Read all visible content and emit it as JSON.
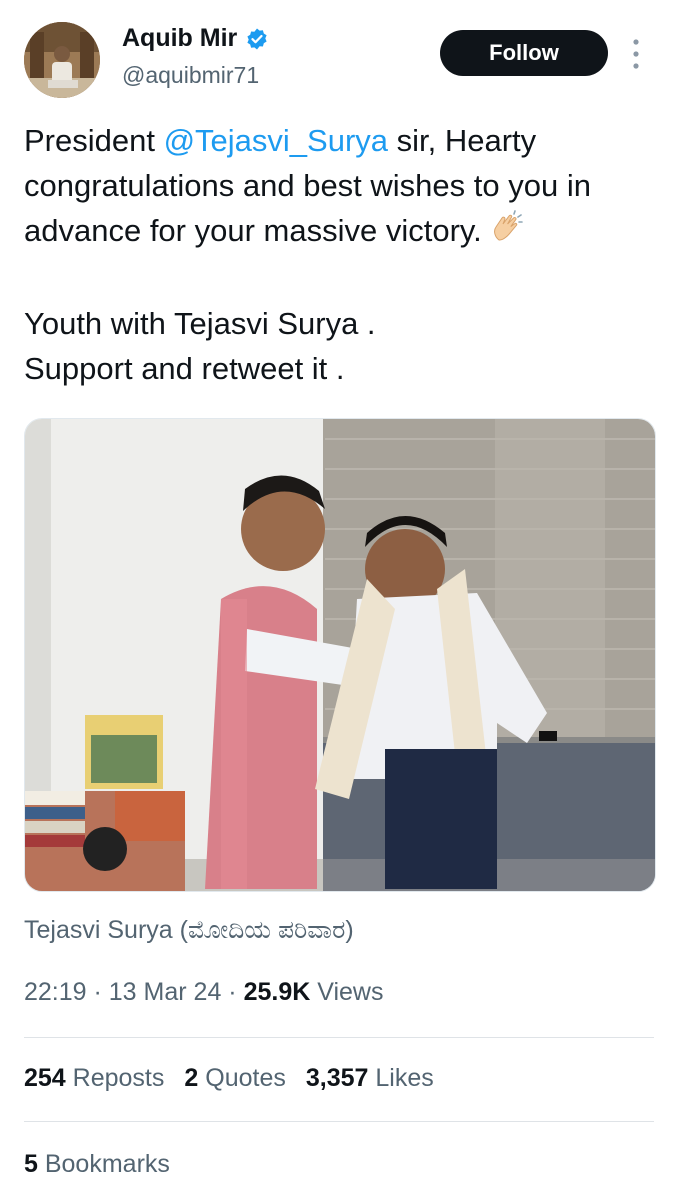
{
  "author": {
    "name": "Aquib Mir",
    "handle": "@aquibmir71",
    "verified": true
  },
  "follow_label": "Follow",
  "tweet": {
    "line1_pre": "President ",
    "mention": "@Tejasvi_Surya",
    "line1_post": " sir, Hearty congratulations and best wishes to you in advance for your massive victory.",
    "emoji": "clapping-hands",
    "para2_line1": "Youth with Tejasvi Surya .",
    "para2_line2": "Support and retweet it ."
  },
  "media_caption": "Tejasvi Surya (ಮೋದಿಯ ಪರಿವಾರ)",
  "meta": {
    "time": "22:19",
    "sep1": " · ",
    "date": "13 Mar 24",
    "sep2": " · ",
    "views_count": "25.9K",
    "views_label": " Views"
  },
  "stats": {
    "reposts_count": "254",
    "reposts_label": " Reposts",
    "quotes_count": "2",
    "quotes_label": " Quotes",
    "likes_count": "3,357",
    "likes_label": " Likes"
  },
  "bookmarks": {
    "count": "5",
    "label": " Bookmarks"
  },
  "colors": {
    "accent": "#1d9bf0",
    "text": "#0f1419",
    "secondary": "#536471",
    "follow_bg": "#0f1419"
  }
}
